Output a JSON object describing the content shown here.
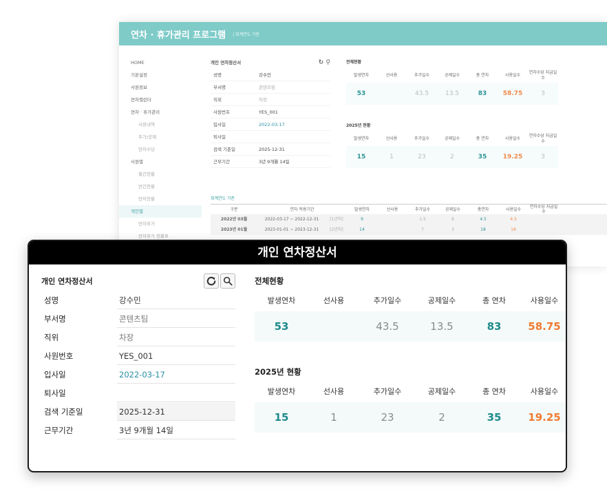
{
  "app": {
    "title": "연차 · 휴가관리 프로그램",
    "subtitle": "| 회계연도 기준"
  },
  "nav": [
    {
      "label": "HOME",
      "level": 0
    },
    {
      "label": "기본설정",
      "level": 0
    },
    {
      "label": "사원정보",
      "level": 0
    },
    {
      "label": "연차캘린더",
      "level": 0
    },
    {
      "label": "연차 · 휴가관리",
      "level": 0
    },
    {
      "label": "사용내역",
      "level": 1
    },
    {
      "label": "추가/공제",
      "level": 1
    },
    {
      "label": "연차수당",
      "level": 1
    },
    {
      "label": "사원별",
      "level": 0
    },
    {
      "label": "월간현황",
      "level": 1
    },
    {
      "label": "연간현황",
      "level": 1
    },
    {
      "label": "연차현황",
      "level": 1
    },
    {
      "label": "개인별",
      "level": 0,
      "active": true
    },
    {
      "label": "연차휴가",
      "level": 1
    },
    {
      "label": "연차휴가 현황표",
      "level": 1
    }
  ],
  "bg_left": {
    "title": "개인 연차정산서",
    "rows": [
      {
        "k": "성명",
        "v": "강수민"
      },
      {
        "k": "부서명",
        "v": "콘텐츠팀"
      },
      {
        "k": "직위",
        "v": "차장"
      },
      {
        "k": "사원번호",
        "v": "YES_001"
      },
      {
        "k": "입사일",
        "v": "2022-03-17"
      },
      {
        "k": "퇴사일",
        "v": ""
      },
      {
        "k": "검색 기준일",
        "v": "2025-12-31"
      },
      {
        "k": "근무기간",
        "v": "3년 9개월 14일"
      }
    ]
  },
  "bg_right": {
    "total_title": "전체현황",
    "year_title": "2025년 현황",
    "headers": [
      "발생연차",
      "선사용",
      "추가일수",
      "공제일수",
      "총 연차",
      "사용일수",
      "연차수당 지급일수"
    ],
    "total_values": [
      "53",
      "",
      "43.5",
      "13.5",
      "83",
      "58.75",
      "3"
    ],
    "year_values": [
      "15",
      "1",
      "23",
      "2",
      "35",
      "19.25",
      "3"
    ]
  },
  "bg_bottom": {
    "title": "회계연도 기준",
    "headers": [
      "구분",
      "연차 적용기간",
      "발생연차",
      "선사용",
      "추가일수",
      "공제일수",
      "총연차",
      "사용일수",
      "연차수당 지급일수"
    ],
    "rows": [
      {
        "gubun": "2022년 03월",
        "period": "2022-03-17 ~ 2022-12-31",
        "tag": "[1년차]",
        "a": "9",
        "b": "",
        "c": "1.5",
        "d": "6",
        "e": "4.5",
        "f": "4.5"
      },
      {
        "gubun": "2023년 01월",
        "period": "2023-01-01 ~ 2023-12-31",
        "tag": "[2년차]",
        "a": "14",
        "b": "",
        "c": "7",
        "d": "3",
        "e": "18",
        "f": "18"
      }
    ]
  },
  "panel": {
    "title": "개인 연차정산서",
    "left_title": "개인 연차정산서",
    "refresh_icon": "refresh-icon",
    "search_icon": "search-icon",
    "info": {
      "name_label": "성명",
      "name": "강수민",
      "dept_label": "부서명",
      "dept": "콘텐츠팀",
      "position_label": "직위",
      "position": "차장",
      "empno_label": "사원번호",
      "empno": "YES_001",
      "join_label": "입사일",
      "join": "2022-03-17",
      "leave_label": "퇴사일",
      "leave": "",
      "base_label": "검색 기준일",
      "base": "2025-12-31",
      "period_label": "근무기간",
      "period": "3년 9개월 14일"
    },
    "total": {
      "title": "전체현황",
      "headers": [
        "발생연차",
        "선사용",
        "추가일수",
        "공제일수",
        "총 연차",
        "사용일수"
      ],
      "values": [
        "53",
        "",
        "43.5",
        "13.5",
        "83",
        "58.75"
      ]
    },
    "year": {
      "title": "2025년 현황",
      "headers": [
        "발생연차",
        "선사용",
        "추가일수",
        "공제일수",
        "총 연차",
        "사용일수"
      ],
      "values": [
        "15",
        "1",
        "23",
        "2",
        "35",
        "19.25"
      ]
    }
  },
  "colors": {
    "header_teal": "#7ecbc8",
    "value_teal": "#1f8a8c",
    "value_orange": "#f07a30",
    "link_blue": "#2b8ea3"
  }
}
